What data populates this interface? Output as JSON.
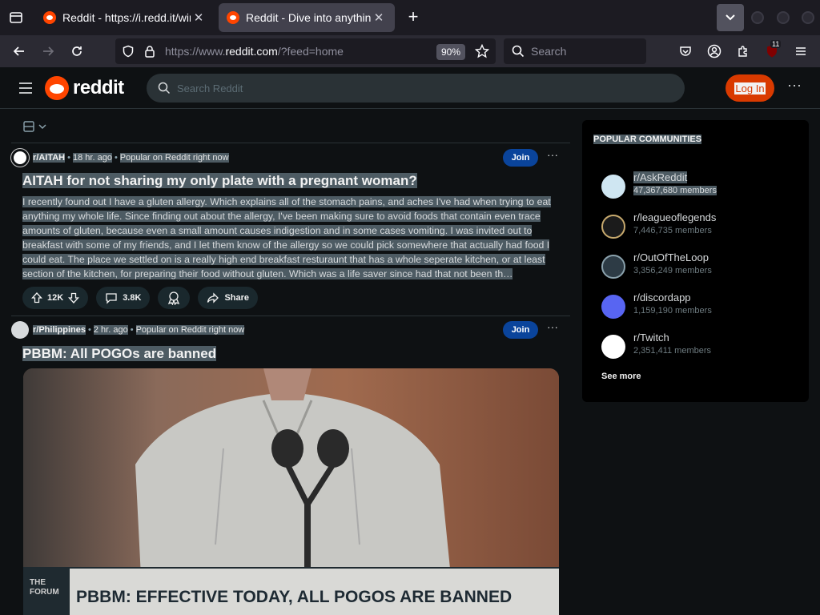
{
  "browser": {
    "tabs": [
      {
        "title": "Reddit - https://i.redd.it/wir",
        "active": false
      },
      {
        "title": "Reddit - Dive into anything",
        "active": true
      }
    ],
    "url_prefix": "https://www.",
    "url_domain": "reddit.com",
    "url_suffix": "/?feed=home",
    "zoom": "90%",
    "search_placeholder": "Search",
    "extension_badge": "11"
  },
  "reddit": {
    "logo_text": "reddit",
    "search_placeholder": "Search Reddit",
    "login_label": "Log In"
  },
  "posts": [
    {
      "subreddit": "r/AITAH",
      "time": "18 hr. ago",
      "context": "Popular on Reddit right now",
      "join_label": "Join",
      "title": "AITAH for not sharing my only plate with a pregnant woman?",
      "body": "I recently found out I have a gluten allergy. Which explains all of the stomach pains, and aches I've had when trying to eat anything my whole life. Since finding out about the allergy, I've been making sure to avoid foods that contain even trace amounts of gluten, because even a small amount causes indigestion and in some cases vomiting. I was invited out to breakfast with some of my friends, and I let them know of the allergy so we could pick somewhere that actually had food I could eat. The place we settled on is a really high end breakfast resturaunt that has a whole seperate kitchen, or at least section of the kitchen, for preparing their food without gluten. Which was a life saver since had that not been th…",
      "votes": "12K",
      "comments": "3.8K",
      "share_label": "Share"
    },
    {
      "subreddit": "r/Philippines",
      "time": "2 hr. ago",
      "context": "Popular on Reddit right now",
      "join_label": "Join",
      "title": "PBBM: All POGOs are banned",
      "image_caption": "PBBM: EFFECTIVE TODAY, ALL POGOS ARE BANNED",
      "image_logo": "THE FORUM"
    }
  ],
  "sidebar": {
    "title": "POPULAR COMMUNITIES",
    "communities": [
      {
        "name": "r/AskReddit",
        "members": "47,367,680 members",
        "color": "#cfe6f2"
      },
      {
        "name": "r/leagueoflegends",
        "members": "7,446,735 members",
        "color": "#c8aa6e"
      },
      {
        "name": "r/OutOfTheLoop",
        "members": "3,356,249 members",
        "color": "#2d3b45"
      },
      {
        "name": "r/discordapp",
        "members": "1,159,190 members",
        "color": "#5865f2"
      },
      {
        "name": "r/Twitch",
        "members": "2,351,411 members",
        "color": "#ffffff"
      }
    ],
    "see_more": "See more"
  }
}
